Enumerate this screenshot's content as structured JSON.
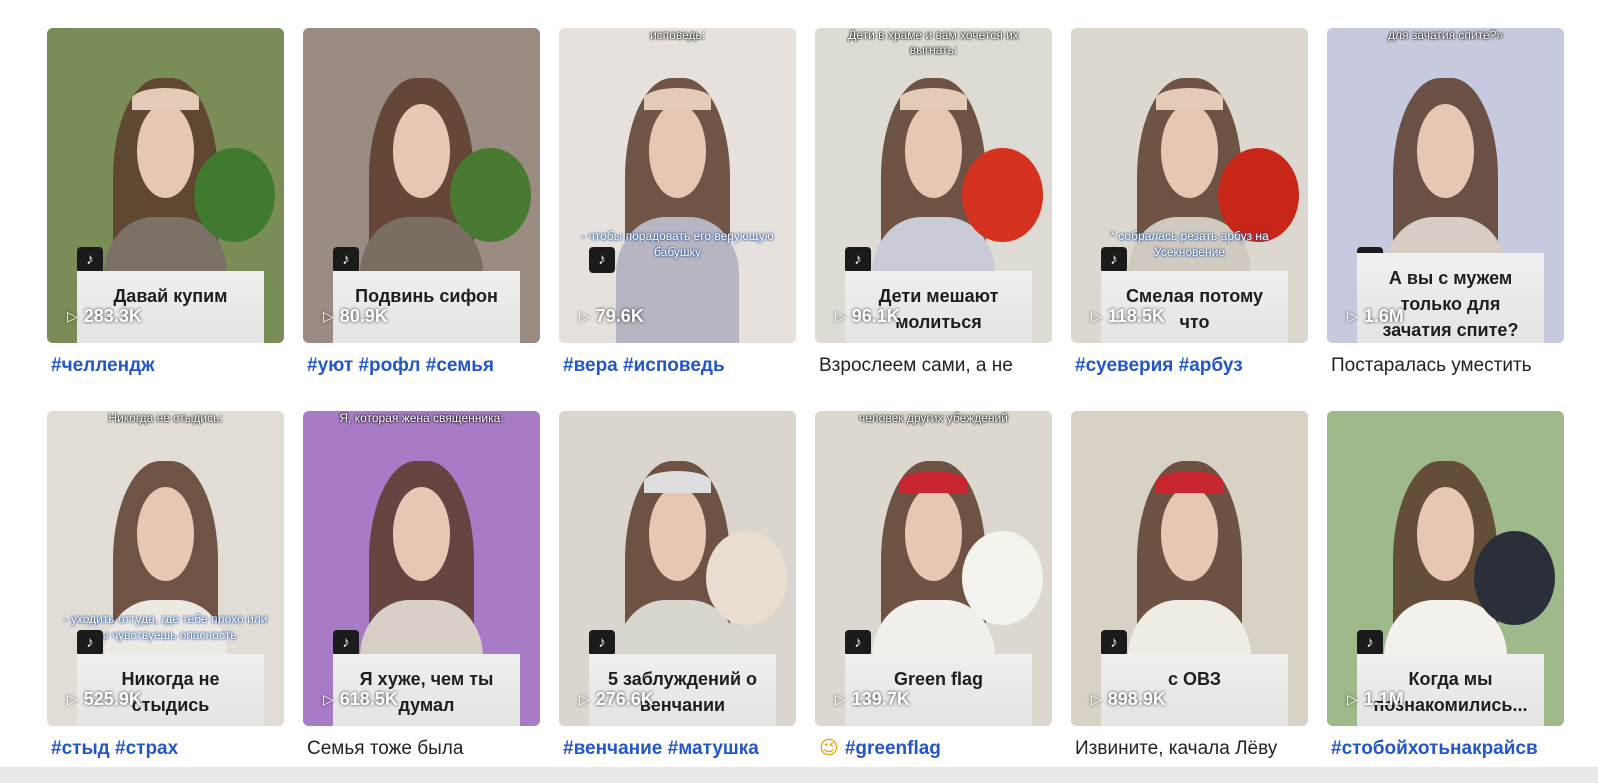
{
  "videos": [
    {
      "caption": "Давай купим",
      "views": "283.3K",
      "top_text": "",
      "mid_text": "",
      "description": "#челлендж",
      "description_is_tags": true,
      "bg": "#7b8d56",
      "dress": "#7b7166",
      "band": "#e3cbb7",
      "prop": "#3f7a2e"
    },
    {
      "caption": "Подвинь сифон",
      "views": "80.9K",
      "top_text": "",
      "mid_text": "",
      "description": "#уют #рофл #семья",
      "description_is_tags": true,
      "bg": "#9a8c83",
      "dress": "#7a6d62",
      "band": "",
      "prop": "#4a7a32"
    },
    {
      "caption": "",
      "views": "79.6K",
      "top_text": "исповедь:",
      "mid_text": "- чтобы порадовать его верующую бабушку",
      "description": "#вера #исповедь",
      "description_is_tags": true,
      "bg": "#e6e1dc",
      "dress": "#b7b5c1",
      "band": "#e3cbb7",
      "prop": ""
    },
    {
      "caption": "Дети мешают молиться",
      "views": "96.1K",
      "top_text": "Дети в храме и вам хочется их выгнать:",
      "mid_text": "",
      "description": "Взрослеем сами, а не",
      "description_is_tags": false,
      "bg": "#dedbd5",
      "dress": "#c9cbd6",
      "band": "#e3cbb7",
      "prop": "#d4321e"
    },
    {
      "caption": "Смелая потому что",
      "views": "118.5K",
      "top_text": "",
      "mid_text": "* собралась резать арбуз на Усекновение",
      "description": "#суеверия #арбуз",
      "description_is_tags": true,
      "bg": "#dcd8cf",
      "dress": "#cfc9c0",
      "band": "#e3cbb7",
      "prop": "#c9261a"
    },
    {
      "caption": "А вы с мужем только для зачатия спите?",
      "views": "1.6M",
      "top_text": "для зачатия спите?»",
      "mid_text": "",
      "description": "Постаралась уместить",
      "description_is_tags": false,
      "bg": "#c7c9df",
      "dress": "#d8cdc5",
      "band": "",
      "prop": ""
    },
    {
      "caption": "Никогда не стыдись",
      "views": "525.9K",
      "top_text": "Никогда не стыдись:",
      "mid_text": "- уходить оттуда, где тебе плохо или ты чувствуешь опасность",
      "description": "#стыд #страх",
      "description_is_tags": true,
      "bg": "#e1ddd6",
      "dress": "#ece8e2",
      "band": "",
      "prop": ""
    },
    {
      "caption": "Я хуже, чем ты думал",
      "views": "618.5K",
      "top_text": "Я, которая жена священника:",
      "mid_text": "",
      "description": "Семья тоже была",
      "description_is_tags": false,
      "bg": "#a77bc6",
      "dress": "#d8cfc6",
      "band": "",
      "prop": ""
    },
    {
      "caption": "5 заблуждений о венчании",
      "views": "276.6K",
      "top_text": "",
      "mid_text": "",
      "description": "#венчание #матушка",
      "description_is_tags": true,
      "bg": "#dad6cf",
      "dress": "#d9d5cf",
      "band": "#dedede",
      "prop": "#e8ddd0"
    },
    {
      "caption": "Green flag",
      "views": "139.7K",
      "top_text": "человек других убеждений",
      "mid_text": "",
      "description": "#greenflag",
      "description_emoji": "😉",
      "description_is_tags": true,
      "bg": "#dcd8d0",
      "dress": "#f1efea",
      "band": "#c7262f",
      "prop": "#f4f2ec"
    },
    {
      "caption": "с ОВЗ",
      "views": "898.9K",
      "top_text": "",
      "mid_text": "",
      "description": "Извините, качала Лёву",
      "description_is_tags": false,
      "bg": "#d7d1c6",
      "dress": "#efece6",
      "band": "#c7262f",
      "prop": ""
    },
    {
      "caption": "Когда мы познакомились...",
      "views": "1.1M",
      "top_text": "",
      "mid_text": "",
      "description": "#стобойхотьнакрайсв",
      "description_is_tags": true,
      "bg": "#9fb98a",
      "dress": "#f3f1ec",
      "band": "",
      "prop": "#2b2f3a"
    }
  ],
  "colors": {
    "tag": "#2356c8",
    "text": "#222222",
    "caption_bg": "#e4e4e4"
  },
  "icons": {
    "platform": "tiktok-icon",
    "views": "play-icon"
  }
}
